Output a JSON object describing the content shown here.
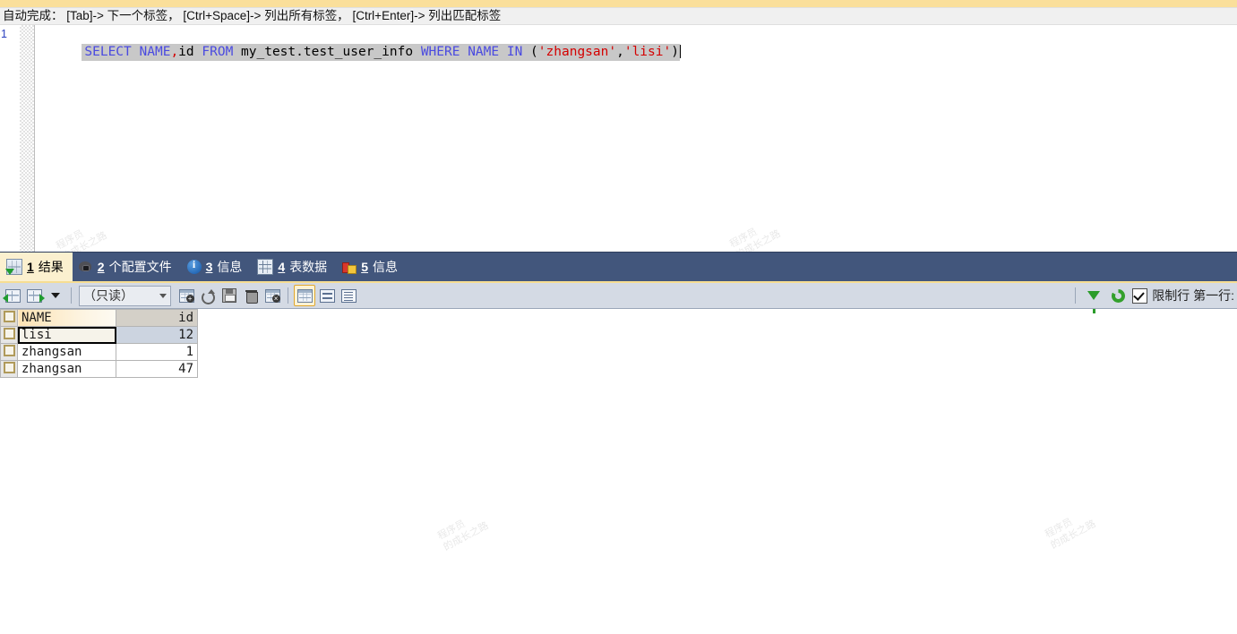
{
  "editor": {
    "hint": "自动完成： [Tab]-> 下一个标签， [Ctrl+Space]-> 列出所有标签， [Ctrl+Enter]-> 列出匹配标签",
    "line_number": "1",
    "sql_tokens": [
      {
        "t": "SELECT",
        "k": "kw"
      },
      {
        "t": " ",
        "k": "plain"
      },
      {
        "t": "NAME",
        "k": "kw"
      },
      {
        "t": ",",
        "k": "comma"
      },
      {
        "t": "id",
        "k": "plain"
      },
      {
        "t": " ",
        "k": "plain"
      },
      {
        "t": "FROM",
        "k": "kw"
      },
      {
        "t": " my_test.test_user_info ",
        "k": "plain"
      },
      {
        "t": "WHERE",
        "k": "kw"
      },
      {
        "t": " ",
        "k": "plain"
      },
      {
        "t": "NAME",
        "k": "kw"
      },
      {
        "t": " ",
        "k": "plain"
      },
      {
        "t": "IN",
        "k": "kw"
      },
      {
        "t": " (",
        "k": "punct"
      },
      {
        "t": "'zhangsan'",
        "k": "str"
      },
      {
        "t": ",",
        "k": "plain"
      },
      {
        "t": "'lisi'",
        "k": "str"
      },
      {
        "t": ")",
        "k": "punct"
      }
    ],
    "sql_text": "SELECT NAME,id FROM my_test.test_user_info WHERE NAME IN ('zhangsan','lisi')"
  },
  "watermarks": [
    "程序员\n的成长之路",
    "程序员\n的成长之路",
    "程序员\n的成长之路",
    "程序员\n的成长之路"
  ],
  "tabs": [
    {
      "num": "1",
      "label": "结果",
      "icon": "result-grid-icon",
      "active": true
    },
    {
      "num": "2",
      "label": "个配置文件",
      "icon": "profile-icon",
      "active": false
    },
    {
      "num": "3",
      "label": "信息",
      "icon": "info-icon",
      "active": false
    },
    {
      "num": "4",
      "label": "表数据",
      "icon": "table-data-icon",
      "active": false
    },
    {
      "num": "5",
      "label": "信息",
      "icon": "chart-info-icon",
      "active": false
    }
  ],
  "toolbar": {
    "export_icon": "export-grid-icon",
    "import_icon": "import-grid-icon",
    "dropdown_icon": "chevron-down-icon",
    "mode_select_value": "（只读）",
    "add_row_icon": "add-row-icon",
    "revert_icon": "revert-row-icon",
    "save_icon": "save-icon",
    "delete_icon": "delete-row-icon",
    "cancel_icon": "cancel-row-icon",
    "view_grid_icon": "grid-view-icon",
    "view_form_icon": "form-view-icon",
    "view_text_icon": "text-view-icon",
    "filter_icon": "filter-icon",
    "refresh_icon": "refresh-icon",
    "limit_checkbox_checked": true,
    "limit_label": "限制行 第一行:"
  },
  "grid": {
    "columns": [
      "NAME",
      "id"
    ],
    "rows": [
      {
        "NAME": "lisi",
        "id": "12",
        "selected": true
      },
      {
        "NAME": "zhangsan",
        "id": "1",
        "selected": false
      },
      {
        "NAME": "zhangsan",
        "id": "47",
        "selected": false
      }
    ]
  },
  "colors": {
    "top_strip": "#fadf9b",
    "tabbar_bg": "#42567c",
    "tab_active_bg": "#fbf0cf",
    "tabbar_underline": "#f6dd92",
    "toolbar_bg": "#d4dae4",
    "sql_keyword": "#4a4ae0",
    "sql_string": "#d40000",
    "selection": "#c8c8c8",
    "header_name_accent": "#fde3b4"
  }
}
